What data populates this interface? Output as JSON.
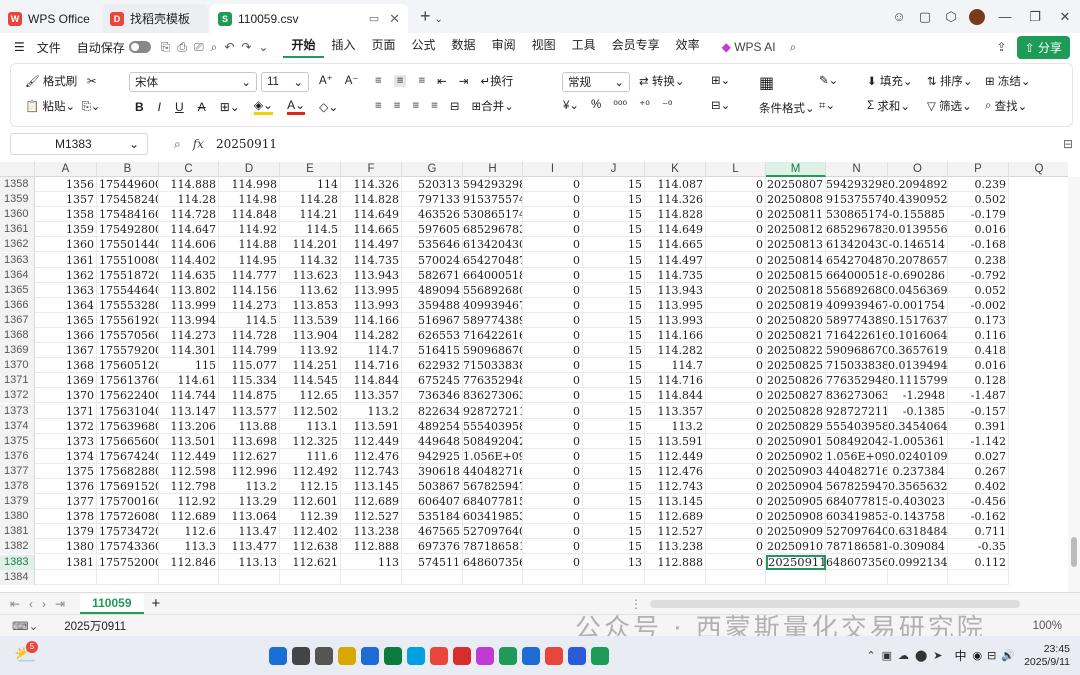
{
  "tabs": [
    {
      "label": "WPS Office",
      "color": "#e8463a",
      "glyph": "W"
    },
    {
      "label": "找稻壳模板",
      "color": "#e8463a",
      "glyph": "D"
    },
    {
      "label": "110059.csv",
      "color": "#1e9c57",
      "glyph": "S"
    }
  ],
  "menu": {
    "file": "文件",
    "autosave": "自动保存",
    "items": [
      "开始",
      "插入",
      "页面",
      "公式",
      "数据",
      "审阅",
      "视图",
      "工具",
      "会员专享",
      "效率"
    ],
    "ai": "WPS AI",
    "share": "分享"
  },
  "ribbon": {
    "format_painter": "格式刷",
    "paste": "粘贴",
    "font": "宋体",
    "size": "11",
    "wrap": "换行",
    "merge": "合并",
    "numfmt": "常规",
    "convert": "转换",
    "cond_format": "条件格式",
    "fill": "填充",
    "sort": "排序",
    "freeze": "冻结",
    "sum": "求和",
    "filter": "筛选",
    "find": "查找"
  },
  "formula_bar": {
    "cell": "M1383",
    "fx": "fx",
    "value": "20250911"
  },
  "columns": [
    "A",
    "B",
    "C",
    "D",
    "E",
    "F",
    "G",
    "H",
    "I",
    "J",
    "K",
    "L",
    "M",
    "N",
    "O",
    "P",
    "Q"
  ],
  "rows": [
    [
      "1358",
      "1356",
      "175449600",
      "114.888",
      "114.998",
      "114",
      "114.326",
      "520313",
      "594293298",
      "0",
      "15",
      "114.087",
      "0",
      "20250807",
      "594293298",
      "0.2094892",
      "0.239"
    ],
    [
      "1359",
      "1357",
      "175458240",
      "114.28",
      "114.98",
      "114.28",
      "114.828",
      "797133",
      "915375574",
      "0",
      "15",
      "114.326",
      "0",
      "20250808",
      "915375574",
      "0.4390952",
      "0.502"
    ],
    [
      "1360",
      "1358",
      "175484160",
      "114.728",
      "114.848",
      "114.21",
      "114.649",
      "463526",
      "530865174",
      "0",
      "15",
      "114.828",
      "0",
      "20250811",
      "530865174",
      "-0.155885",
      "-0.179"
    ],
    [
      "1361",
      "1359",
      "175492800",
      "114.647",
      "114.92",
      "114.5",
      "114.665",
      "597605",
      "685296783",
      "0",
      "15",
      "114.649",
      "0",
      "20250812",
      "685296783",
      "0.0139556",
      "0.016"
    ],
    [
      "1362",
      "1360",
      "175501440",
      "114.606",
      "114.88",
      "114.201",
      "114.497",
      "535646",
      "613420430",
      "0",
      "15",
      "114.665",
      "0",
      "20250813",
      "613420430",
      "-0.146514",
      "-0.168"
    ],
    [
      "1363",
      "1361",
      "175510080",
      "114.402",
      "114.95",
      "114.32",
      "114.735",
      "570024",
      "654270487",
      "0",
      "15",
      "114.497",
      "0",
      "20250814",
      "654270487",
      "0.2078657",
      "0.238"
    ],
    [
      "1364",
      "1362",
      "175518720",
      "114.635",
      "114.777",
      "113.623",
      "113.943",
      "582671",
      "664000518",
      "0",
      "15",
      "114.735",
      "0",
      "20250815",
      "664000518",
      "-0.690286",
      "-0.792"
    ],
    [
      "1365",
      "1363",
      "175544640",
      "113.802",
      "114.156",
      "113.62",
      "113.995",
      "489094",
      "556892680",
      "0",
      "15",
      "113.943",
      "0",
      "20250818",
      "556892680",
      "0.0456369",
      "0.052"
    ],
    [
      "1366",
      "1364",
      "175553280",
      "113.999",
      "114.273",
      "113.853",
      "113.993",
      "359488",
      "409939467",
      "0",
      "15",
      "113.995",
      "0",
      "20250819",
      "409939467",
      "-0.001754",
      "-0.002"
    ],
    [
      "1367",
      "1365",
      "175561920",
      "113.994",
      "114.5",
      "113.539",
      "114.166",
      "516967",
      "589774389",
      "0",
      "15",
      "113.993",
      "0",
      "20250820",
      "589774389",
      "0.1517637",
      "0.173"
    ],
    [
      "1368",
      "1366",
      "175570560",
      "114.273",
      "114.728",
      "113.904",
      "114.282",
      "626553",
      "716422616",
      "0",
      "15",
      "114.166",
      "0",
      "20250821",
      "716422616",
      "0.1016064",
      "0.116"
    ],
    [
      "1369",
      "1367",
      "175579200",
      "114.301",
      "114.799",
      "113.92",
      "114.7",
      "516415",
      "590968670",
      "0",
      "15",
      "114.282",
      "0",
      "20250822",
      "590968670",
      "0.3657619",
      "0.418"
    ],
    [
      "1370",
      "1368",
      "175605120",
      "115",
      "115.077",
      "114.251",
      "114.716",
      "622932",
      "715033838",
      "0",
      "15",
      "114.7",
      "0",
      "20250825",
      "715033838",
      "0.0139494",
      "0.016"
    ],
    [
      "1371",
      "1369",
      "175613760",
      "114.61",
      "115.334",
      "114.545",
      "114.844",
      "675245",
      "776352948",
      "0",
      "15",
      "114.716",
      "0",
      "20250826",
      "776352948",
      "0.1115799",
      "0.128"
    ],
    [
      "1372",
      "1370",
      "175622400",
      "114.744",
      "114.875",
      "112.65",
      "113.357",
      "736346",
      "836273063",
      "0",
      "15",
      "114.844",
      "0",
      "20250827",
      "836273063",
      "-1.2948",
      "-1.487"
    ],
    [
      "1373",
      "1371",
      "175631040",
      "113.147",
      "113.577",
      "112.502",
      "113.2",
      "822634",
      "928727211",
      "0",
      "15",
      "113.357",
      "0",
      "20250828",
      "928727211",
      "-0.1385",
      "-0.157"
    ],
    [
      "1374",
      "1372",
      "175639680",
      "113.206",
      "113.88",
      "113.1",
      "113.591",
      "489254",
      "555403958",
      "0",
      "15",
      "113.2",
      "0",
      "20250829",
      "555403958",
      "0.3454064",
      "0.391"
    ],
    [
      "1375",
      "1373",
      "175665600",
      "113.501",
      "113.698",
      "112.325",
      "112.449",
      "449648",
      "508492042",
      "0",
      "15",
      "113.591",
      "0",
      "20250901",
      "508492042",
      "-1.005361",
      "-1.142"
    ],
    [
      "1376",
      "1374",
      "175674240",
      "112.449",
      "112.627",
      "111.6",
      "112.476",
      "942925",
      "1.056E+09",
      "0",
      "15",
      "112.449",
      "0",
      "20250902",
      "1.056E+09",
      "0.0240109",
      "0.027"
    ],
    [
      "1377",
      "1375",
      "175682880",
      "112.598",
      "112.996",
      "112.492",
      "112.743",
      "390618",
      "440482716",
      "0",
      "15",
      "112.476",
      "0",
      "20250903",
      "440482716",
      "0.237384",
      "0.267"
    ],
    [
      "1378",
      "1376",
      "175691520",
      "112.798",
      "113.2",
      "112.15",
      "113.145",
      "503867",
      "567825947",
      "0",
      "15",
      "112.743",
      "0",
      "20250904",
      "567825947",
      "0.3565632",
      "0.402"
    ],
    [
      "1379",
      "1377",
      "175700160",
      "112.92",
      "113.29",
      "112.601",
      "112.689",
      "606407",
      "684077815",
      "0",
      "15",
      "113.145",
      "0",
      "20250905",
      "684077815",
      "-0.403023",
      "-0.456"
    ],
    [
      "1380",
      "1378",
      "175726080",
      "112.689",
      "113.064",
      "112.39",
      "112.527",
      "535184",
      "603419853",
      "0",
      "15",
      "112.689",
      "0",
      "20250908",
      "603419853",
      "-0.143758",
      "-0.162"
    ],
    [
      "1381",
      "1379",
      "175734720",
      "112.6",
      "113.47",
      "112.402",
      "113.238",
      "467565",
      "527097640",
      "0",
      "15",
      "112.527",
      "0",
      "20250909",
      "527097640",
      "0.6318484",
      "0.711"
    ],
    [
      "1382",
      "1380",
      "175743360",
      "113.3",
      "113.477",
      "112.638",
      "112.888",
      "697376",
      "787186581",
      "0",
      "15",
      "113.238",
      "0",
      "20250910",
      "787186581",
      "-0.309084",
      "-0.35"
    ],
    [
      "1383",
      "1381",
      "175752000",
      "112.846",
      "113.13",
      "112.621",
      "113",
      "574511",
      "648607356",
      "0",
      "13",
      "112.888",
      "0",
      "20250911",
      "648607356",
      "0.0992134",
      "0.112"
    ],
    [
      "1384",
      "",
      "",
      "",
      "",
      "",
      "",
      "",
      "",
      "",
      "",
      "",
      "",
      "",
      "",
      "",
      ""
    ]
  ],
  "sheet_tab": "110059",
  "status_text": "2025万0911",
  "zoom": "100%",
  "watermark": "公众号 · 西蒙斯量化交易研究院",
  "clock": {
    "time": "23:45",
    "date": "2025/9/11"
  },
  "weather_badge": "5",
  "ime": "中"
}
